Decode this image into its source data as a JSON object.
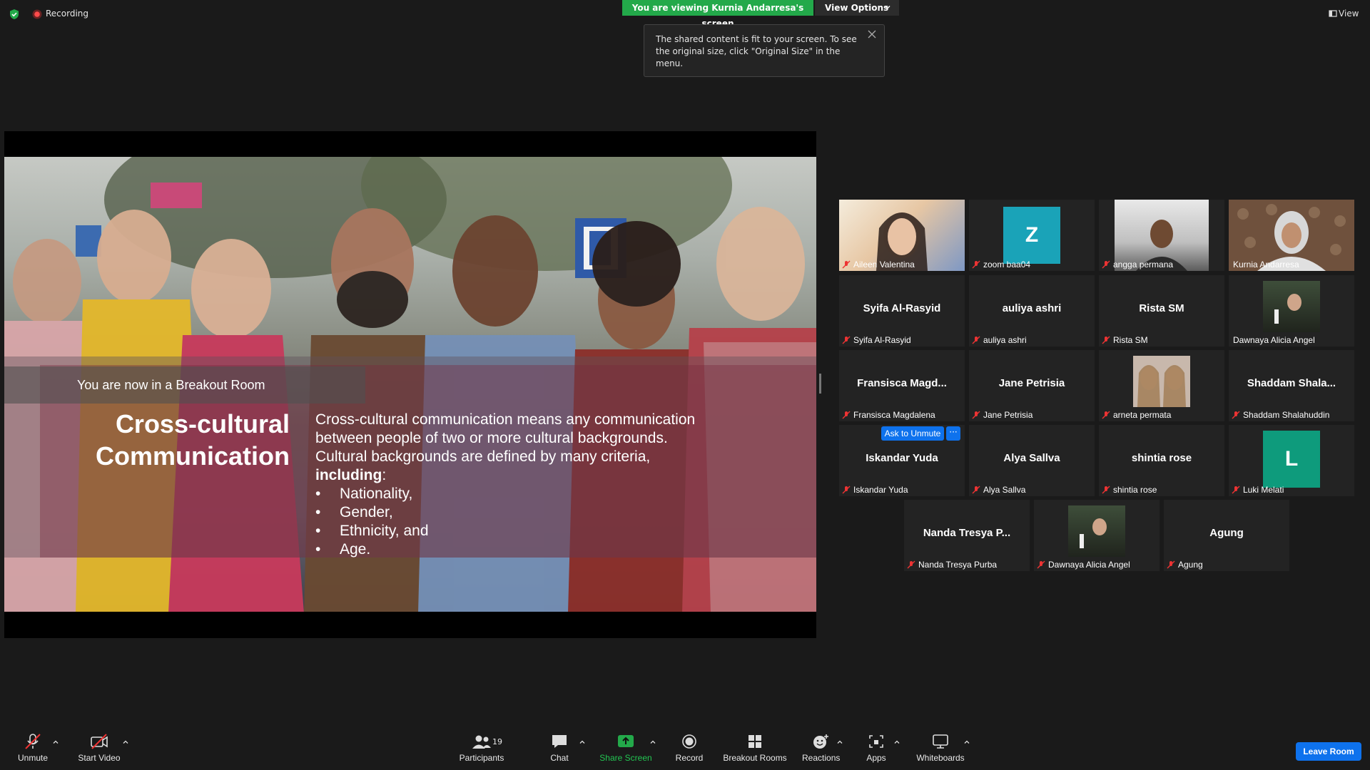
{
  "topbar": {
    "recording_label": "Recording",
    "viewing_banner": "You are viewing Kurnia Andarresa's screen",
    "view_options_label": "View Options",
    "tooltip_text": "The shared content is fit to your screen. To see the original size, click \"Original Size\" in the menu.",
    "view_label": "View",
    "colors": {
      "green": "#23a94a",
      "blue": "#0e72ed",
      "highlight": "#e8e26a"
    }
  },
  "slide": {
    "breakout_note": "You are now in a Breakout Room",
    "title_line1": "Cross-cultural",
    "title_line2": "Communication",
    "body_line1": "Cross-cultural communication means any communication",
    "body_line2": "between people of two or more cultural backgrounds.",
    "body_line3": "Cultural backgrounds are defined by many criteria,",
    "body_bold": "including",
    "body_colon": ":",
    "bullets": [
      "Nationality,",
      "Gender,",
      "Ethnicity, and",
      "Age."
    ]
  },
  "gallery": {
    "tiles": [
      {
        "name": "Aileen Valentina"
      },
      {
        "name": "zoom baa04",
        "avatar": "Z"
      },
      {
        "name": "angga permana"
      },
      {
        "name": "Kurnia Andarresa"
      },
      {
        "name": "Syifa Al-Rasyid",
        "big": "Syifa Al-Rasyid"
      },
      {
        "name": "auliya ashri",
        "big": "auliya ashri"
      },
      {
        "name": "Rista SM",
        "big": "Rista SM"
      },
      {
        "name": "Dawnaya Alicia Angel"
      },
      {
        "name": "Fransisca Magdalena",
        "big": "Fransisca  Magd..."
      },
      {
        "name": "Jane Petrisia",
        "big": "Jane Petrisia"
      },
      {
        "name": "arneta permata"
      },
      {
        "name": "Shaddam Shalahuddin",
        "big": "Shaddam  Shala..."
      },
      {
        "name": "Iskandar Yuda",
        "big": "Iskandar Yuda"
      },
      {
        "name": "Alya Sallva",
        "big": "Alya Sallva"
      },
      {
        "name": "shintia rose",
        "big": "shintia rose"
      },
      {
        "name": "Luki Melati",
        "avatar": "L"
      },
      {
        "name": "Nanda Tresya Purba",
        "big": "Nanda Tresya P..."
      },
      {
        "name": "Dawnaya Alicia Angel"
      },
      {
        "name": "Agung",
        "big": "Agung"
      }
    ],
    "ask_to_unmute": "Ask to Unmute",
    "more_label": "···"
  },
  "toolbar": {
    "unmute": "Unmute",
    "start_video": "Start Video",
    "participants": "Participants",
    "participants_count": "19",
    "chat": "Chat",
    "share_screen": "Share Screen",
    "record": "Record",
    "breakout_rooms": "Breakout Rooms",
    "reactions": "Reactions",
    "apps": "Apps",
    "whiteboards": "Whiteboards",
    "leave_room": "Leave Room"
  }
}
